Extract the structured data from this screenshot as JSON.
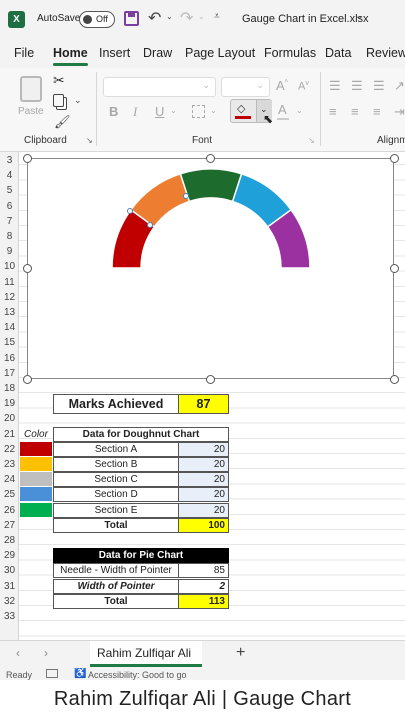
{
  "titlebar": {
    "autosave_label": "AutoSave",
    "autosave_state": "Off",
    "filename": "Gauge Chart in Excel.xlsx"
  },
  "ribbon_tabs": [
    "File",
    "Home",
    "Insert",
    "Draw",
    "Page Layout",
    "Formulas",
    "Data",
    "Review"
  ],
  "ribbon": {
    "paste_label": "Paste",
    "clipboard_label": "Clipboard",
    "font_label": "Font",
    "alignment_label": "Alignm"
  },
  "row_numbers": [
    "3",
    "4",
    "5",
    "6",
    "7",
    "8",
    "9",
    "10",
    "11",
    "12",
    "13",
    "14",
    "15",
    "16",
    "17",
    "18",
    "19",
    "20",
    "21",
    "22",
    "23",
    "24",
    "25",
    "26",
    "27",
    "28",
    "29",
    "30",
    "31",
    "32",
    "33"
  ],
  "marks": {
    "label": "Marks Achieved",
    "value": "87"
  },
  "doughnut_table": {
    "color_header": "Color",
    "header": "Data for Doughnut Chart",
    "rows": [
      {
        "label": "Section A",
        "value": "20",
        "color": "#c00000"
      },
      {
        "label": "Section B",
        "value": "20",
        "color": "#ffc000"
      },
      {
        "label": "Section C",
        "value": "20",
        "color": "#bfbfbf"
      },
      {
        "label": "Section D",
        "value": "20",
        "color": "#4a90d9"
      },
      {
        "label": "Section E",
        "value": "20",
        "color": "#00b050"
      }
    ],
    "total_label": "Total",
    "total_value": "100"
  },
  "pie_table": {
    "header": "Data for Pie Chart",
    "rows": [
      {
        "label": "Needle - Width of Pointer",
        "value": "85"
      },
      {
        "label": "Width of Pointer",
        "value": "2"
      }
    ],
    "total_label": "Total",
    "total_value": "113"
  },
  "gauge_segments": [
    {
      "value": 20,
      "color": "#c00000"
    },
    {
      "value": 20,
      "color": "#ed7d31"
    },
    {
      "value": 20,
      "color": "#1e6b2e"
    },
    {
      "value": 20,
      "color": "#1fa0d8"
    },
    {
      "value": 20,
      "color": "#9b30a0"
    }
  ],
  "sheet_tab": "Rahim Zulfiqar Ali",
  "status": {
    "ready": "Ready",
    "accessibility": "Accessibility: Good to go"
  },
  "caption": "Rahim Zulfiqar Ali | Gauge Chart"
}
